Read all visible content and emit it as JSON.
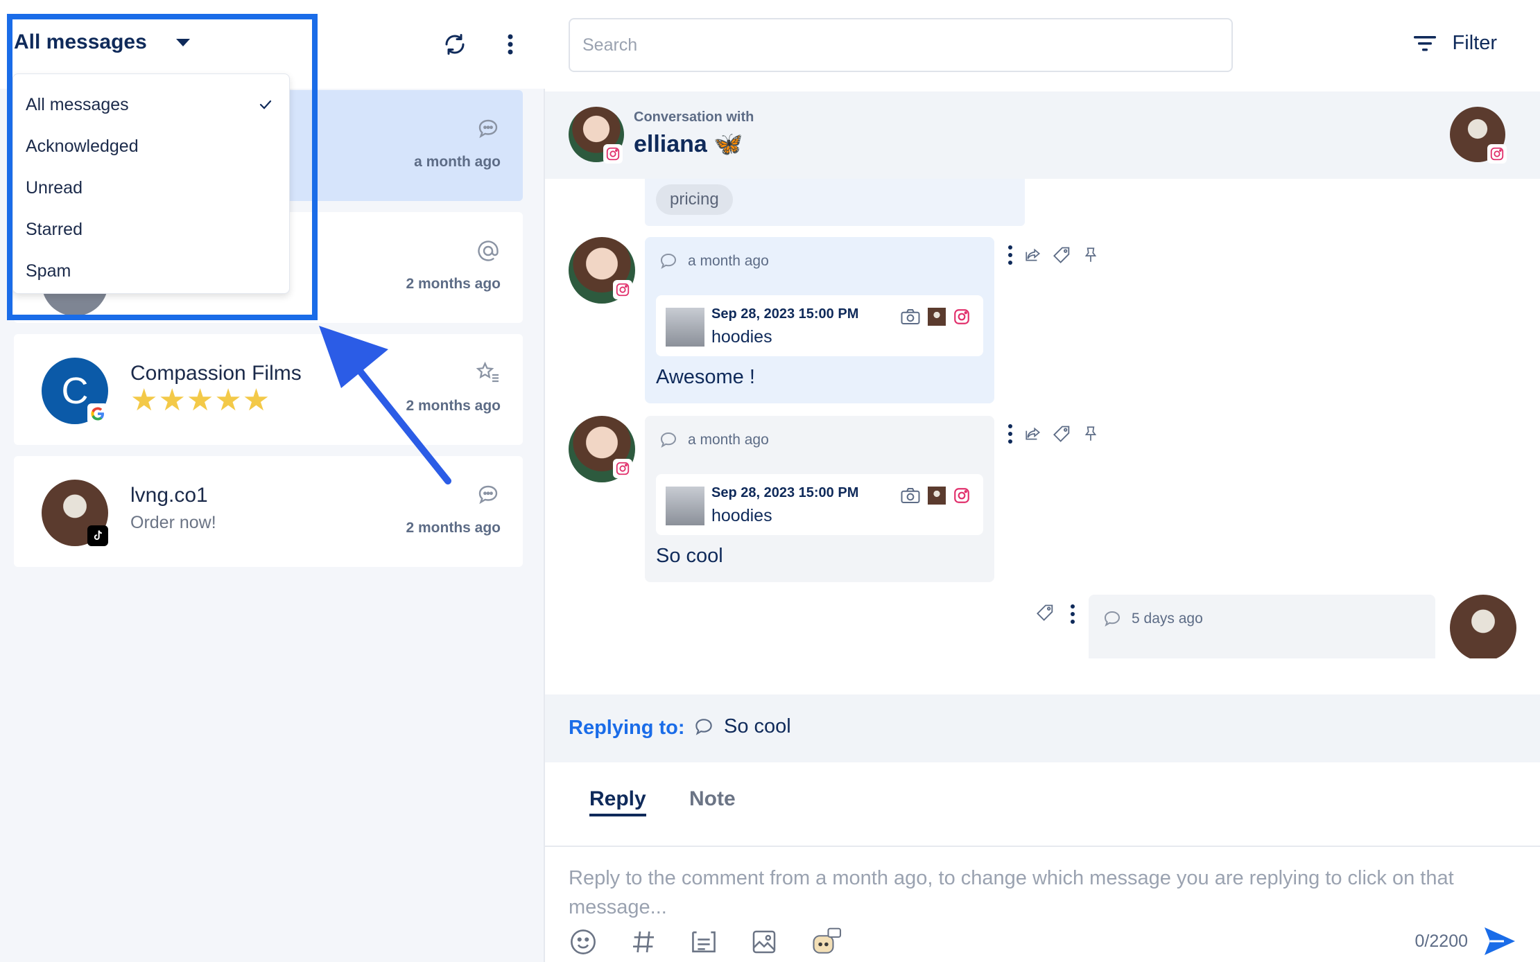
{
  "filter": {
    "selected": "All messages",
    "options": [
      "All messages",
      "Acknowledged",
      "Unread",
      "Starred",
      "Spam"
    ]
  },
  "conversations": [
    {
      "name": "",
      "preview": "",
      "time": "a month ago",
      "type_icon": "comment-icon"
    },
    {
      "name": "",
      "preview": "",
      "time": "2 months ago",
      "type_icon": "mention-icon"
    },
    {
      "name": "Compassion Films",
      "avatar_letter": "C",
      "rating": 5,
      "stars": "★★★★★",
      "time": "2 months ago",
      "type_icon": "star-list-icon",
      "platform": "google"
    },
    {
      "name": "lvng.co1",
      "preview": "Order now!",
      "time": "2 months ago",
      "type_icon": "comment-icon",
      "platform": "tiktok"
    }
  ],
  "search": {
    "placeholder": "Search",
    "value": ""
  },
  "filter_button": {
    "label": "Filter"
  },
  "conversation_header": {
    "subtitle": "Conversation with",
    "name": "elliana 🦋"
  },
  "thread": {
    "tag": "pricing",
    "messages": [
      {
        "time": "a month ago",
        "post_date": "Sep 28, 2023 15:00 PM",
        "post_title": "hoodies",
        "text": "Awesome !"
      },
      {
        "time": "a month ago",
        "post_date": "Sep 28, 2023 15:00 PM",
        "post_title": "hoodies",
        "text": "So cool"
      }
    ],
    "outgoing": {
      "time": "5 days ago"
    }
  },
  "reply": {
    "label": "Replying to:",
    "target": "So cool"
  },
  "tabs": {
    "reply": "Reply",
    "note": "Note"
  },
  "composer": {
    "placeholder": "Reply to the comment from a month ago, to change which message you are replying to click on that message...",
    "char_count": "0/2200"
  },
  "colors": {
    "accent": "#1a6ce8",
    "navy": "#0f2a5a",
    "instagram": "#e1306c",
    "star": "#f3c948"
  }
}
